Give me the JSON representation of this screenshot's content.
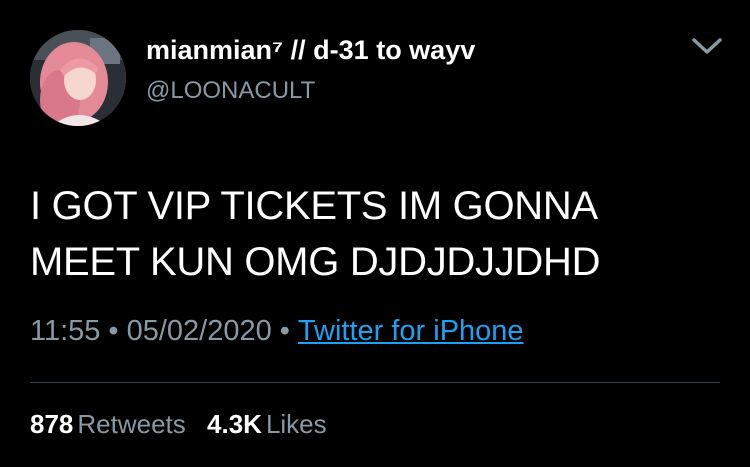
{
  "user": {
    "display_name": "mianmian⁷ // d-31 to wayv",
    "handle": "@LOONACULT"
  },
  "tweet": {
    "line1": "I GOT VIP TICKETS IM GONNA",
    "line2": "MEET KUN OMG DJDJDJJDHD"
  },
  "meta": {
    "time": "11:55",
    "separator": "•",
    "date": "05/02/2020",
    "source": "Twitter for iPhone"
  },
  "stats": {
    "retweets_count": "878",
    "retweets_label": "Retweets",
    "likes_count": "4.3K",
    "likes_label": "Likes"
  },
  "icons": {
    "menu": "chevron-down-icon",
    "avatar": "profile-avatar"
  },
  "colors": {
    "background": "#000000",
    "primary_text": "#ffffff",
    "secondary_text": "#8899a6",
    "link": "#1da1f2",
    "divider": "#38444d"
  }
}
